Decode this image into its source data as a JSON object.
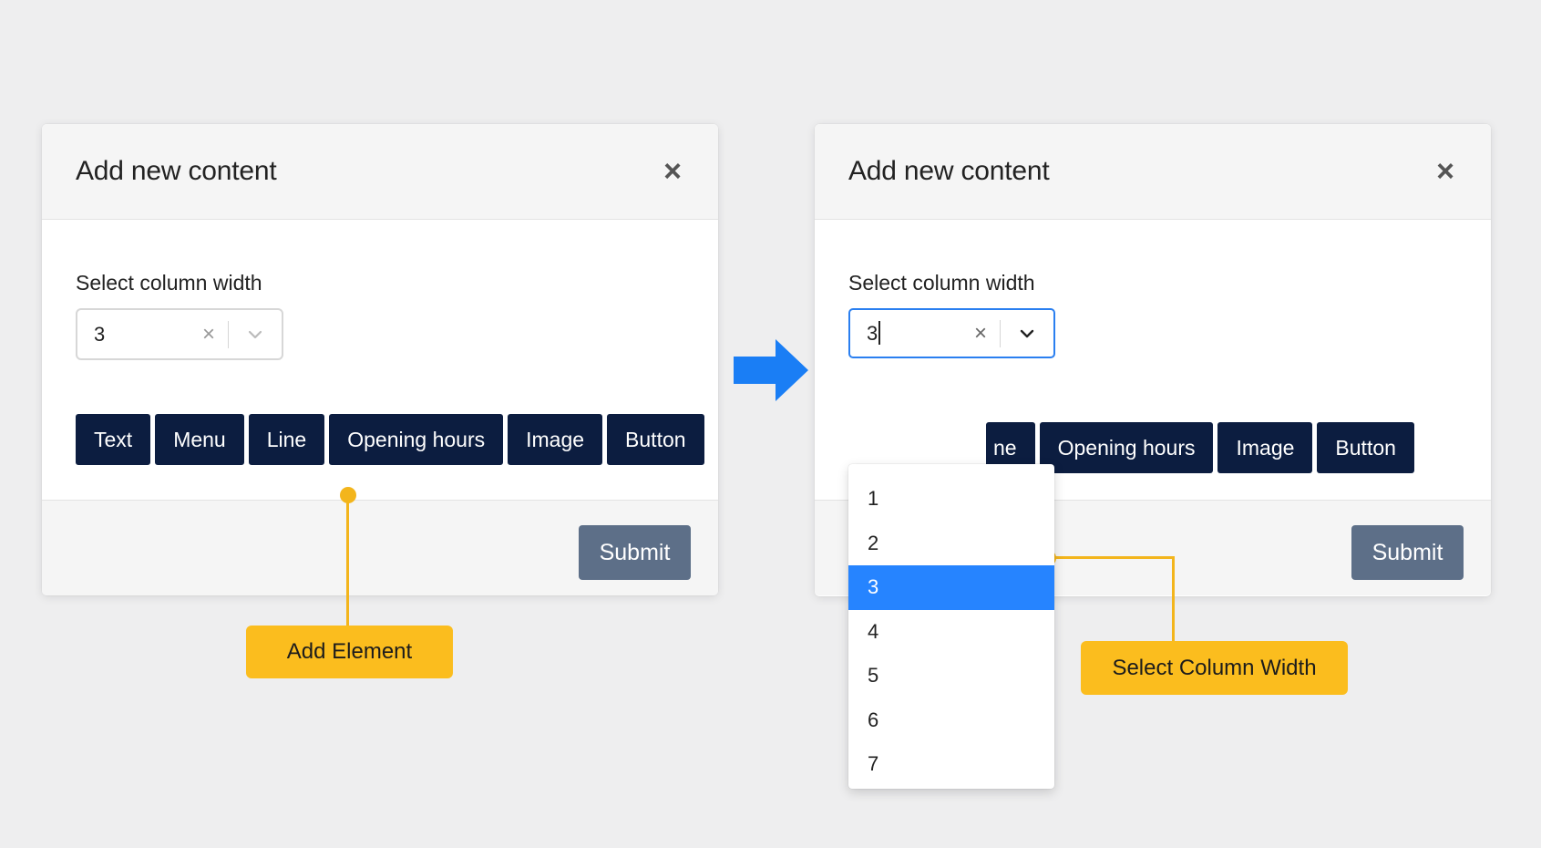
{
  "left_modal": {
    "title": "Add new content",
    "close_icon": "×",
    "field_label": "Select column width",
    "select_value": "3",
    "clear_icon": "×",
    "element_buttons": [
      "Text",
      "Menu",
      "Line",
      "Opening hours",
      "Image",
      "Button"
    ],
    "submit_label": "Submit"
  },
  "right_modal": {
    "title": "Add new content",
    "close_icon": "×",
    "field_label": "Select column width",
    "select_value": "3",
    "clear_icon": "×",
    "element_buttons": [
      "ne",
      "Opening hours",
      "Image",
      "Button"
    ],
    "submit_label": "Submit",
    "dropdown_options": [
      "1",
      "2",
      "3",
      "4",
      "5",
      "6",
      "7"
    ],
    "selected_option": "3"
  },
  "annotations": {
    "add_element": "Add Element",
    "select_column_width": "Select Column Width"
  },
  "icons": {
    "close": "close-icon",
    "clear": "clear-icon",
    "chevron": "chevron-down-icon",
    "flow_arrow": "arrow-right-icon"
  },
  "colors": {
    "primary_button": "#0c1d40",
    "submit_button": "#5d6f88",
    "focus_border": "#2a7ff0",
    "selected_option": "#2684ff",
    "annotation": "#fbbd1e",
    "arrow": "#1a7ef5"
  }
}
